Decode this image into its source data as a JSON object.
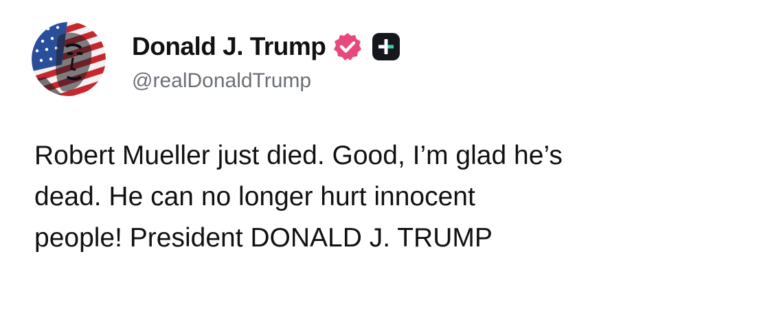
{
  "author": {
    "display_name": "Donald J. Trump",
    "handle": "@realDonaldTrump",
    "verified_color": "#e8497a",
    "badge_color": "#15171c",
    "avatar_icon": "profile-photo"
  },
  "post": {
    "lines": [
      "Robert Mueller just died. Good, I’m glad he’s",
      "dead. He can no longer hurt innocent",
      "people! President DONALD J. TRUMP"
    ]
  }
}
